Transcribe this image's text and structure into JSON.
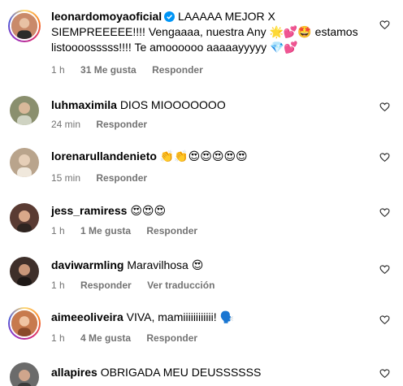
{
  "comments": [
    {
      "username": "leonardomoyaoficial",
      "verified": true,
      "text": "LAAAAA MEJOR X SIEMPREEEEE!!!! Vengaaaa, nuestra Any 🌟💕🤩 estamos listoooosssss!!!! Te amoooooo aaaaayyyyy 💎💕",
      "time": "1 h",
      "likes": "31 Me gusta",
      "reply": "Responder",
      "avatar_color": "#c98a6a"
    },
    {
      "username": "luhmaximila",
      "text": "DIOS MIOOOOOOO",
      "time": "24 min",
      "reply": "Responder",
      "avatar_color": "#8a8f6e"
    },
    {
      "username": "lorenarullandenieto",
      "text": "👏👏😍😍😍😍😍",
      "time": "15 min",
      "reply": "Responder",
      "avatar_color": "#b9a48c"
    },
    {
      "username": "jess_ramiress",
      "text": "😍😍😍",
      "time": "1 h",
      "likes": "1 Me gusta",
      "reply": "Responder",
      "avatar_color": "#5a3b33"
    },
    {
      "username": "daviwarmling",
      "text": "Maravilhosa 😍",
      "time": "1 h",
      "reply": "Responder",
      "translate": "Ver traducción",
      "avatar_color": "#3e2f2a"
    },
    {
      "username": "aimeeoliveira",
      "text": "VIVA, mamiiiiiiiiiiii! 🗣️",
      "time": "1 h",
      "likes": "4 Me gusta",
      "reply": "Responder",
      "avatar_color": "#c77a4e"
    },
    {
      "username": "allapires",
      "text": "OBRIGADA MEU DEUSSSSSS",
      "avatar_color": "#6b6b6b"
    }
  ],
  "colors": {
    "meta": "#737373",
    "verified": "#0095f6"
  },
  "icons": {
    "like": "heart-outline-icon",
    "verified": "verified-badge-icon"
  }
}
